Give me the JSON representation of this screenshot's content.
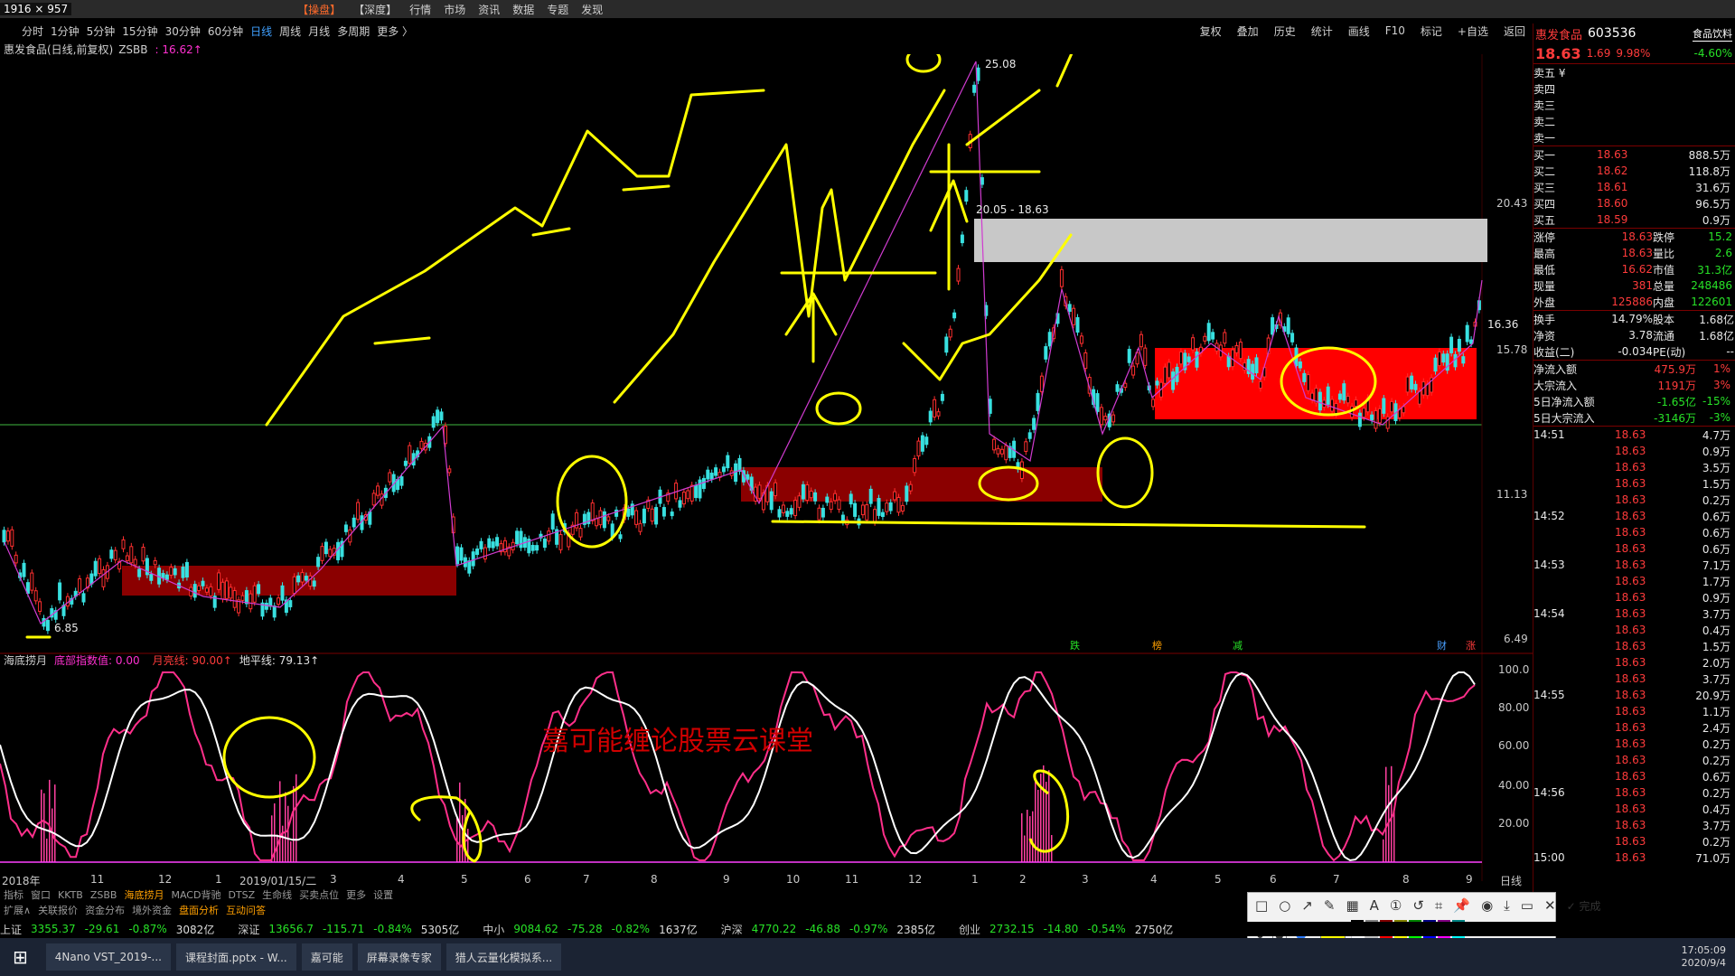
{
  "window": {
    "dims": "1916 × 957"
  },
  "topmenu": [
    "【操盘】",
    "【深度】",
    "行情",
    "市场",
    "资讯",
    "数据",
    "专题",
    "发现"
  ],
  "periods": [
    "分时",
    "1分钟",
    "5分钟",
    "15分钟",
    "30分钟",
    "60分钟",
    "日线",
    "周线",
    "月线",
    "多周期",
    "更多 〉"
  ],
  "active_period": "日线",
  "right_tools": [
    "复权",
    "叠加",
    "历史",
    "统计",
    "画线",
    "F10",
    "标记",
    "+自选",
    "返回"
  ],
  "chart": {
    "title": "惠发食品(日线,前复权)",
    "indicator": "ZSBB",
    "indicator_value": ": 16.62↑",
    "high_label": "25.08",
    "low_label": "6.85",
    "range_label": "20.05 - 18.63",
    "y_ticks": [
      "20.43",
      "16.36",
      "15.78",
      "11.13",
      "6.49"
    ],
    "x_ticks": [
      "2018年",
      "11",
      "12",
      "1",
      "2019/01/15/二",
      "3",
      "4",
      "5",
      "6",
      "7",
      "8",
      "9",
      "10",
      "11",
      "12",
      "1",
      "2",
      "3",
      "4",
      "5",
      "6",
      "7",
      "8",
      "9"
    ],
    "x_axis_mode": "日线",
    "markers": [
      "跌",
      "榜",
      "减",
      "财",
      "涨"
    ]
  },
  "sub_chart": {
    "name": "海底捞月",
    "bottom_label": "底部指数值: 0.00",
    "moon_label": "月亮线: 90.00↑",
    "horizon_label": "地平线: 79.13↑",
    "y_ticks": [
      "100.0",
      "80.00",
      "60.00",
      "40.00",
      "20.00"
    ],
    "watermark": "嘉可能缠论股票云课堂"
  },
  "bottom_tabs": [
    "指标",
    "窗口",
    "KKTB",
    "ZSBB",
    "海底捞月",
    "MACD背驰",
    "DTSZ",
    "生命线",
    "买卖点位",
    "更多",
    "设置"
  ],
  "bottom_tabs2": [
    "扩展∧",
    "关联报价",
    "资金分布",
    "境外资金",
    "盘面分析",
    "互动问答"
  ],
  "quote": {
    "name": "惠发食品",
    "code": "603536",
    "sector": "食品饮料",
    "sector_chg": "-4.60%",
    "price": "18.63",
    "change": "1.69",
    "pct": "9.98%",
    "asks": [
      "卖五 ¥",
      "卖四",
      "卖三",
      "卖二",
      "卖一"
    ],
    "bids": [
      {
        "label": "买一",
        "price": "18.63",
        "vol": "888.5万"
      },
      {
        "label": "买二",
        "price": "18.62",
        "vol": "118.8万"
      },
      {
        "label": "买三",
        "price": "18.61",
        "vol": "31.6万"
      },
      {
        "label": "买四",
        "price": "18.60",
        "vol": "96.5万"
      },
      {
        "label": "买五",
        "price": "18.59",
        "vol": "0.9万"
      }
    ],
    "stats": [
      [
        "涨停",
        "18.63",
        "跌停",
        "15.2"
      ],
      [
        "最高",
        "18.63",
        "量比",
        "2.6"
      ],
      [
        "最低",
        "16.62",
        "市值",
        "31.3亿"
      ],
      [
        "现量",
        "381",
        "总量",
        "248486"
      ],
      [
        "外盘",
        "125886",
        "内盘",
        "122601"
      ]
    ],
    "stats2": [
      [
        "换手",
        "14.79%",
        "股本",
        "1.68亿"
      ],
      [
        "净资",
        "3.78",
        "流通",
        "1.68亿"
      ],
      [
        "收益(二)",
        "-0.034",
        "PE(动)",
        "--"
      ]
    ],
    "flows": [
      [
        "净流入额",
        "475.9万",
        "1%"
      ],
      [
        "大宗流入",
        "1191万",
        "3%"
      ],
      [
        "5日净流入额",
        "-1.65亿",
        "-15%"
      ],
      [
        "5日大宗流入",
        "-3146万",
        "-3%"
      ]
    ],
    "ticks": [
      {
        "t": "14:51",
        "p": "18.63",
        "v": "4.7万"
      },
      {
        "t": "",
        "p": "18.63",
        "v": "0.9万"
      },
      {
        "t": "",
        "p": "18.63",
        "v": "3.5万"
      },
      {
        "t": "",
        "p": "18.63",
        "v": "1.5万"
      },
      {
        "t": "",
        "p": "18.63",
        "v": "0.2万"
      },
      {
        "t": "14:52",
        "p": "18.63",
        "v": "0.6万"
      },
      {
        "t": "",
        "p": "18.63",
        "v": "0.6万"
      },
      {
        "t": "",
        "p": "18.63",
        "v": "0.6万"
      },
      {
        "t": "14:53",
        "p": "18.63",
        "v": "7.1万"
      },
      {
        "t": "",
        "p": "18.63",
        "v": "1.7万"
      },
      {
        "t": "",
        "p": "18.63",
        "v": "0.9万"
      },
      {
        "t": "14:54",
        "p": "18.63",
        "v": "3.7万"
      },
      {
        "t": "",
        "p": "18.63",
        "v": "0.4万"
      },
      {
        "t": "",
        "p": "18.63",
        "v": "1.5万"
      },
      {
        "t": "",
        "p": "18.63",
        "v": "2.0万"
      },
      {
        "t": "",
        "p": "18.63",
        "v": "3.7万"
      },
      {
        "t": "14:55",
        "p": "18.63",
        "v": "20.9万"
      },
      {
        "t": "",
        "p": "18.63",
        "v": "1.1万"
      },
      {
        "t": "",
        "p": "18.63",
        "v": "2.4万"
      },
      {
        "t": "",
        "p": "18.63",
        "v": "0.2万"
      },
      {
        "t": "",
        "p": "18.63",
        "v": "0.2万"
      },
      {
        "t": "",
        "p": "18.63",
        "v": "0.6万"
      },
      {
        "t": "14:56",
        "p": "18.63",
        "v": "0.2万"
      },
      {
        "t": "",
        "p": "18.63",
        "v": "0.4万"
      },
      {
        "t": "",
        "p": "18.63",
        "v": "3.7万"
      },
      {
        "t": "",
        "p": "18.63",
        "v": "0.2万"
      },
      {
        "t": "15:00",
        "p": "18.63",
        "v": "71.0万"
      }
    ]
  },
  "status_bar": [
    {
      "name": "上证",
      "v": "3355.37",
      "c": "-29.61",
      "p": "-0.87%",
      "amt": "3082亿"
    },
    {
      "name": "深证",
      "v": "13656.7",
      "c": "-115.71",
      "p": "-0.84%",
      "amt": "5305亿"
    },
    {
      "name": "中小",
      "v": "9084.62",
      "c": "-75.28",
      "p": "-0.82%",
      "amt": "1637亿"
    },
    {
      "name": "沪深",
      "v": "4770.22",
      "c": "-46.88",
      "p": "-0.97%",
      "amt": "2385亿"
    },
    {
      "name": "创业",
      "v": "2732.15",
      "c": "-14.80",
      "p": "-0.54%",
      "amt": "2750亿"
    }
  ],
  "draw_toolbar": {
    "done_label": "完成"
  },
  "taskbar": {
    "items": [
      "4Nano VST_2019-...",
      "课程封面.pptx - W...",
      "嘉可能",
      "屏幕录像专家",
      "猎人云量化模拟系..."
    ],
    "time": "17:05:09",
    "date": "2020/9/4"
  },
  "colors": {
    "accent_red": "#ff3b3b",
    "down_green": "#27e227",
    "annotation_yellow": "#ffff00",
    "zone_dark": "#8b0000",
    "zone_bright": "#ff0000"
  }
}
